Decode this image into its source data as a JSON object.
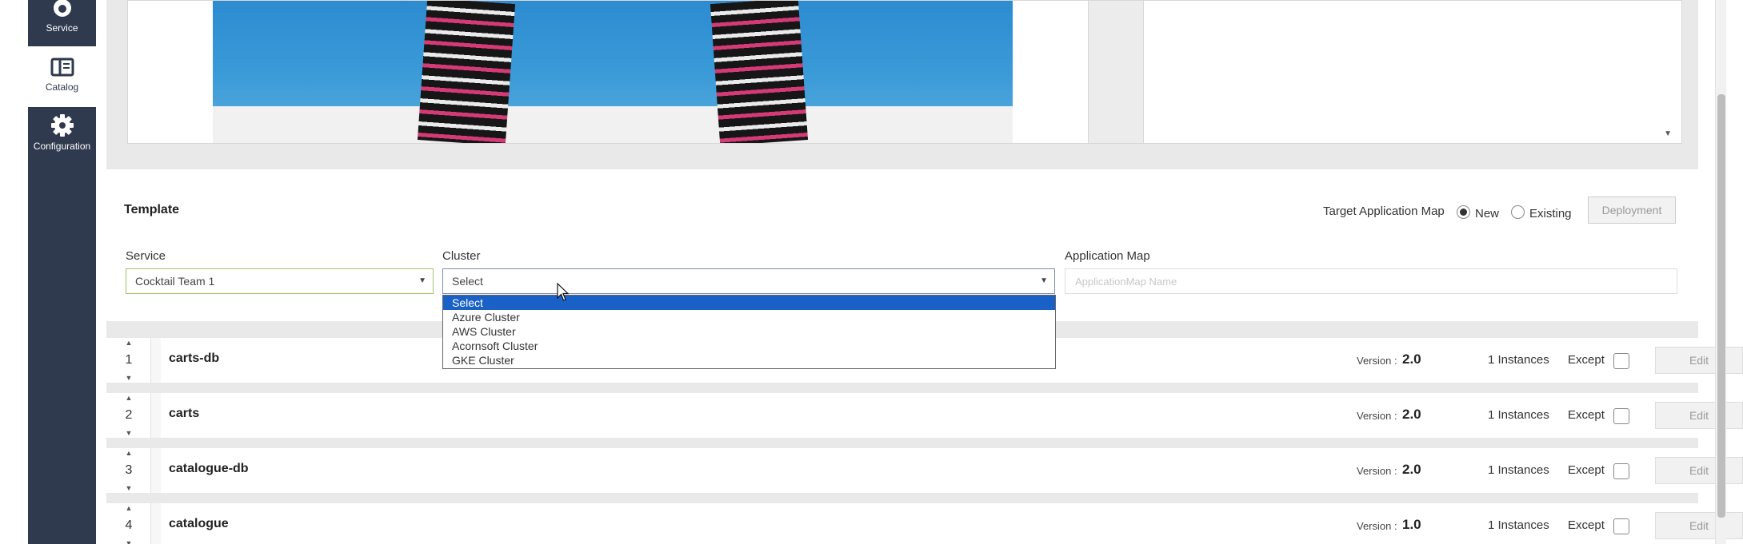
{
  "sidebar": {
    "items": [
      {
        "label": "Service",
        "icon": "cloud-icon"
      },
      {
        "label": "Catalog",
        "icon": "book-icon"
      },
      {
        "label": "Configuration",
        "icon": "gear-icon"
      }
    ],
    "active": "Catalog"
  },
  "template": {
    "title": "Template",
    "target_label": "Target Application Map",
    "radio_new": "New",
    "radio_existing": "Existing",
    "selected_target": "New",
    "deploy_label": "Deployment",
    "service_label": "Service",
    "service_value": "Cocktail Team 1",
    "cluster_label": "Cluster",
    "cluster_value": "Select",
    "appmap_label": "Application Map",
    "appmap_placeholder": "ApplicationMap Name"
  },
  "dropdown": {
    "options": [
      "Select",
      "Azure Cluster",
      "AWS Cluster",
      "Acornsoft Cluster",
      "GKE Cluster"
    ],
    "selected": "Select"
  },
  "rows": [
    {
      "num": "1",
      "name": "carts-db",
      "version_label": "Version :",
      "version": "2.0",
      "instances": "1 Instances",
      "except": "Except",
      "edit": "Edit"
    },
    {
      "num": "2",
      "name": "carts",
      "version_label": "Version :",
      "version": "2.0",
      "instances": "1 Instances",
      "except": "Except",
      "edit": "Edit"
    },
    {
      "num": "3",
      "name": "catalogue-db",
      "version_label": "Version :",
      "version": "2.0",
      "instances": "1 Instances",
      "except": "Except",
      "edit": "Edit"
    },
    {
      "num": "4",
      "name": "catalogue",
      "version_label": "Version :",
      "version": "1.0",
      "instances": "1 Instances",
      "except": "Except",
      "edit": "Edit"
    }
  ],
  "colors": {
    "sidebar": "#2f3a4e",
    "selection": "#1a61c7"
  }
}
